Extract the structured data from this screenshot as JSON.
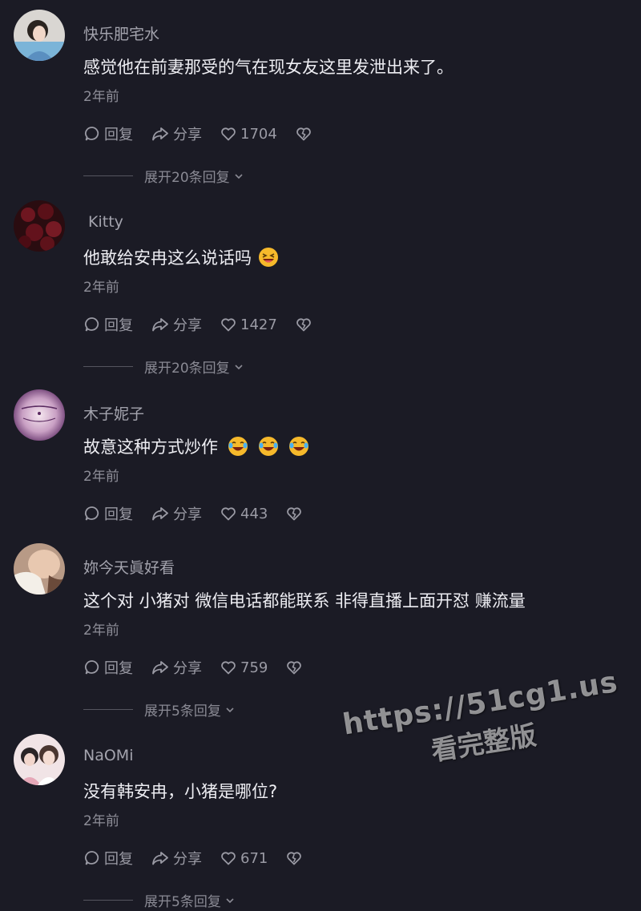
{
  "actions": {
    "reply_label": "回复",
    "share_label": "分享"
  },
  "comments": [
    {
      "username": "快乐肥宅水",
      "text": "感觉他在前妻那受的气在现女友这里发泄出来了。",
      "time": "2年前",
      "likes": "1704",
      "expand_label": "展开20条回复",
      "emojis": []
    },
    {
      "username": "Kitty",
      "text": "他敢给安冉这么说话吗",
      "time": "2年前",
      "likes": "1427",
      "expand_label": "展开20条回复",
      "emojis": [
        "grin-squint-emoji"
      ]
    },
    {
      "username": "木子妮子",
      "text": "故意这种方式炒作",
      "time": "2年前",
      "likes": "443",
      "expand_label": "",
      "emojis": [
        "laugh-tears-emoji",
        "laugh-tears-emoji",
        "laugh-tears-emoji"
      ]
    },
    {
      "username": "妳今天眞好看",
      "text": "这个对 小猪对 微信电话都能联系 非得直播上面开怼 赚流量",
      "time": "2年前",
      "likes": "759",
      "expand_label": "展开5条回复",
      "emojis": []
    },
    {
      "username": "NaOMi",
      "text": "没有韩安冉，小猪是哪位?",
      "time": "2年前",
      "likes": "671",
      "expand_label": "展开5条回复",
      "emojis": []
    }
  ],
  "watermark": {
    "url": "https://51cg1.us",
    "subtitle": "看完整版"
  }
}
